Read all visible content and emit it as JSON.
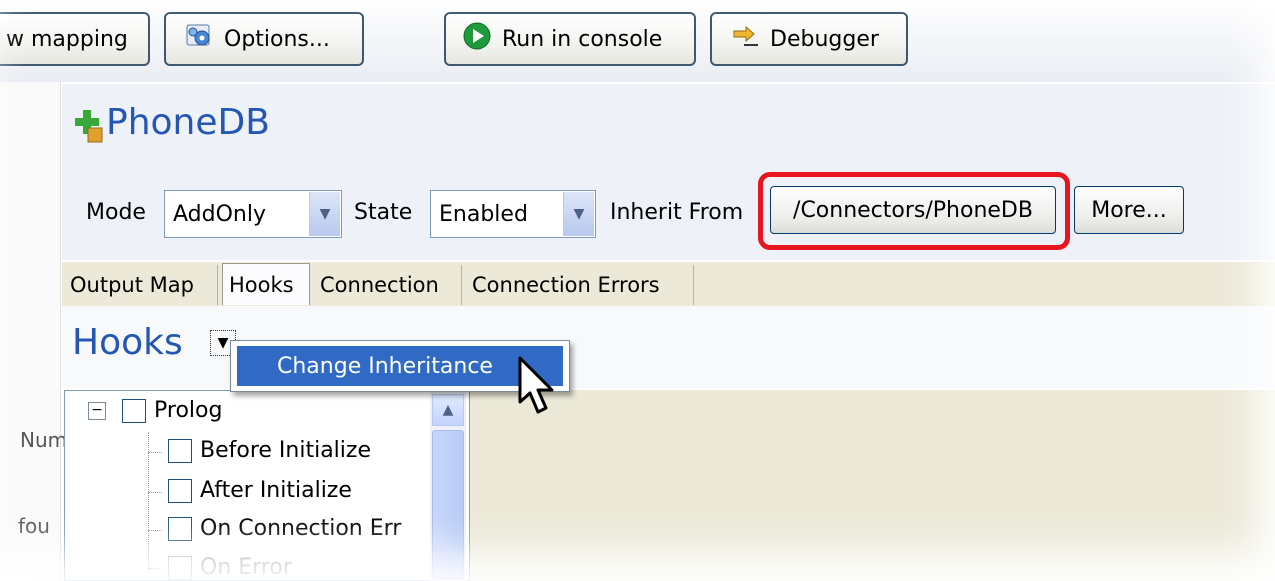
{
  "toolbar": {
    "mapping_label": "w mapping",
    "options_label": "Options...",
    "run_label": "Run in console",
    "debugger_label": "Debugger"
  },
  "component": {
    "title": "PhoneDB",
    "mode_label": "Mode",
    "mode_value": "AddOnly",
    "state_label": "State",
    "state_value": "Enabled",
    "inherit_label": "Inherit From",
    "inherit_value": "/Connectors/PhoneDB",
    "more_label": "More..."
  },
  "tabs": [
    {
      "label": "Output Map",
      "active": false
    },
    {
      "label": "Hooks",
      "active": true
    },
    {
      "label": "Connection",
      "active": false
    },
    {
      "label": "Connection Errors",
      "active": false
    }
  ],
  "hooks": {
    "title": "Hooks",
    "menu_item": "Change Inheritance"
  },
  "tree": {
    "root": "Prolog",
    "children": [
      "Before Initialize",
      "After Initialize",
      "On Connection Err",
      "On Error"
    ]
  },
  "left_fragments": [
    "Num",
    "fou"
  ],
  "colors": {
    "accent": "#2357b3",
    "highlight": "#e8141e",
    "selection": "#316ac5"
  }
}
